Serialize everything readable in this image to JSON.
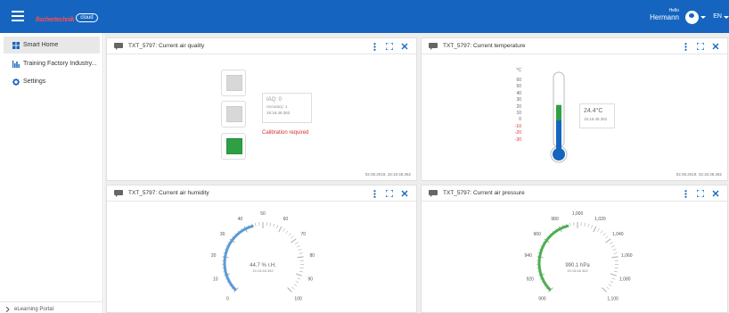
{
  "app": {
    "logo_text": "fischertechnik",
    "logo_cloud": "cloud",
    "user_greeting": "Hello",
    "user_name": "Hermann",
    "language": "EN"
  },
  "sidebar": {
    "items": [
      {
        "label": "Smart Home",
        "icon": "grid-icon",
        "active": true
      },
      {
        "label": "Training Factory Industry...",
        "icon": "bar-chart-icon",
        "active": false
      },
      {
        "label": "Settings",
        "icon": "gear-icon",
        "active": false
      }
    ],
    "bottom_label": "eLearning Portal"
  },
  "colors": {
    "brand": "#1565c0",
    "accent_green": "#2ea043",
    "warning_red": "#d32f2f",
    "gauge_humidity": "#5b9bd5",
    "gauge_pressure": "#4caf50"
  },
  "cards": {
    "air_quality": {
      "title": "TXT_5797: Current air quality",
      "iaq_label": "IAQ: 0",
      "accuracy": "Accuracy: 1",
      "timestamp": "15:16:48.362",
      "calibration": "Calibration required",
      "footer": "02.08.2019, 15:16:48.362",
      "active_level": 3
    },
    "temperature": {
      "title": "TXT_5797: Current temperature",
      "unit": "°C",
      "value": "24.4°C",
      "value_num": 24.4,
      "timestamp": "15:16:48.362",
      "scale": [
        "60",
        "50",
        "40",
        "30",
        "20",
        "10",
        "0",
        "-10",
        "-20",
        "-30"
      ],
      "footer": "02.08.2019, 15:16:48.362"
    },
    "humidity": {
      "title": "TXT_5797: Current air humidity",
      "value": "44.7 % r.H.",
      "value_num": 44.7,
      "timestamp": "15:16:48.362",
      "min": 0,
      "max": 100,
      "ticks": [
        "0",
        "10",
        "20",
        "30",
        "40",
        "50",
        "60",
        "70",
        "80",
        "90",
        "100"
      ]
    },
    "pressure": {
      "title": "TXT_5797: Current air pressure",
      "value": "990.1 hPa",
      "value_num": 990.1,
      "timestamp": "15:16:48.362",
      "min": 900,
      "max": 1100,
      "ticks": [
        "900",
        "920",
        "940",
        "960",
        "980",
        "1,000",
        "1,020",
        "1,040",
        "1,060",
        "1,080",
        "1,100"
      ]
    }
  }
}
